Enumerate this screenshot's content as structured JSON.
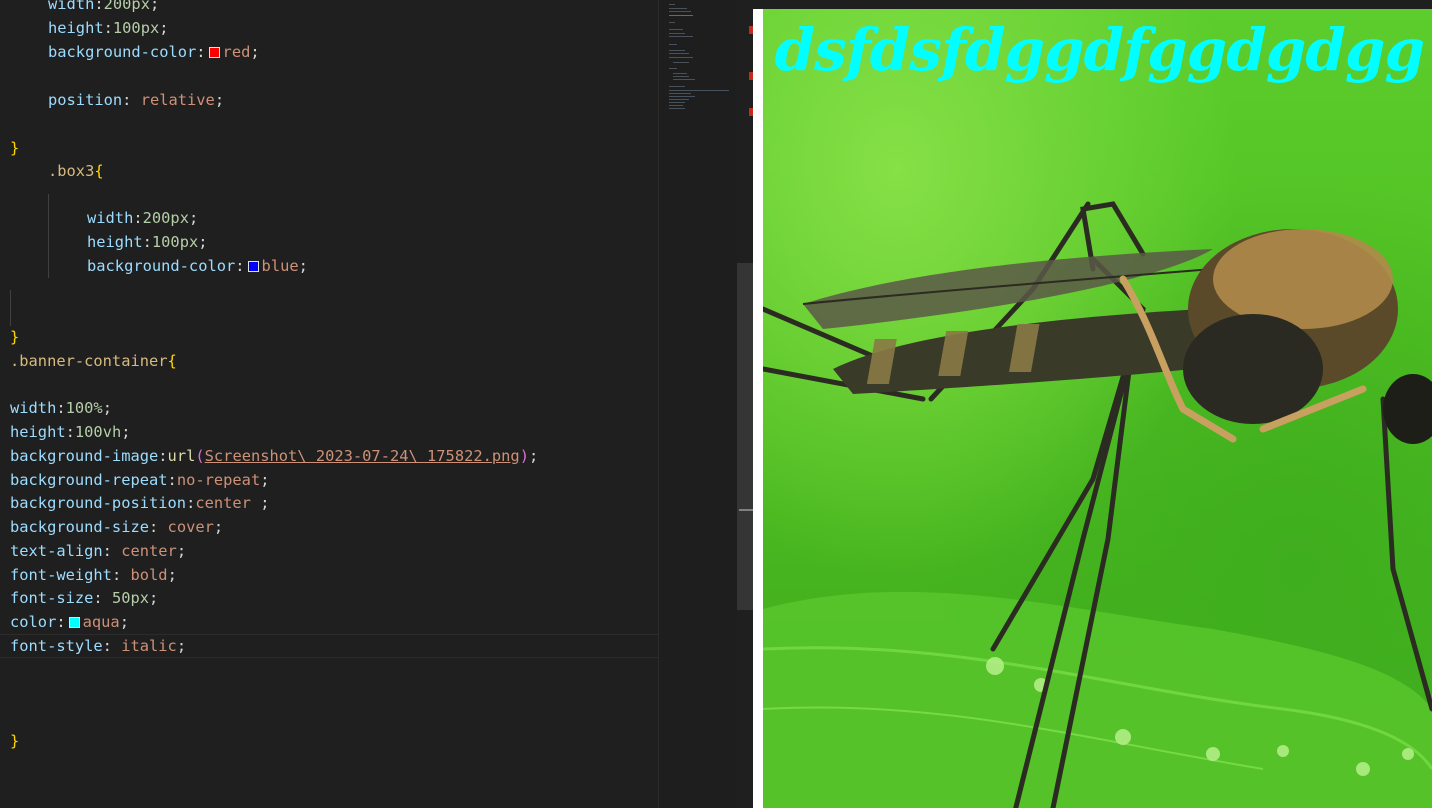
{
  "editor": {
    "lines": [
      {
        "indent": "    ",
        "selector": "",
        "prop": "width",
        "value": "200px",
        "value_kind": "num"
      },
      {
        "indent": "    ",
        "prop": "height",
        "value": "100px",
        "value_kind": "num"
      },
      {
        "indent": "    ",
        "prop": "background-color",
        "value": "red",
        "value_kind": "val",
        "swatch": "#ff0000"
      },
      {
        "indent": "    ",
        "prop": "position",
        "value": "relative",
        "value_kind": "val"
      },
      {
        "brace": "}"
      },
      {
        "selector": ".box3",
        "brace": "{"
      },
      {
        "prop": "width",
        "value": "200px"
      },
      {
        "prop": "height",
        "value": "100px"
      },
      {
        "prop": "background-color",
        "value": "blue",
        "swatch": "#0000ff"
      },
      {
        "brace": "}"
      },
      {
        "selector": ".banner-container",
        "brace": "{"
      },
      {
        "prop": "width",
        "value": "100%"
      },
      {
        "prop": "height",
        "value": "100vh"
      },
      {
        "prop": "background-image",
        "fn": "url",
        "arg": "Screenshot\\ 2023-07-24\\ 175822.png"
      },
      {
        "prop": "background-repeat",
        "value": "no-repeat"
      },
      {
        "prop": "background-position",
        "value": "center "
      },
      {
        "prop": "background-size",
        "value": " cover"
      },
      {
        "prop": "text-align",
        "value": " center"
      },
      {
        "prop": "font-weight",
        "value": " bold"
      },
      {
        "prop": "font-size",
        "value": " 50px"
      },
      {
        "prop": "color",
        "value": "aqua",
        "swatch": "#00ffff"
      },
      {
        "prop": "font-style",
        "value": " italic"
      },
      {
        "brace": "}"
      }
    ]
  },
  "preview": {
    "banner_text": "dsfdsfdggdfggdgdgg",
    "banner_color": "#00ffff",
    "image_subject": "mosquito-on-leaf"
  },
  "colors": {
    "editor_bg": "#1f1f1f",
    "property": "#9cdcfe",
    "value": "#ce9178",
    "number": "#b5cea8",
    "selector": "#d7ba7d",
    "brace": "#ffd700",
    "swatch_red": "#ff0000",
    "swatch_blue": "#0000ff",
    "swatch_aqua": "#00ffff"
  }
}
